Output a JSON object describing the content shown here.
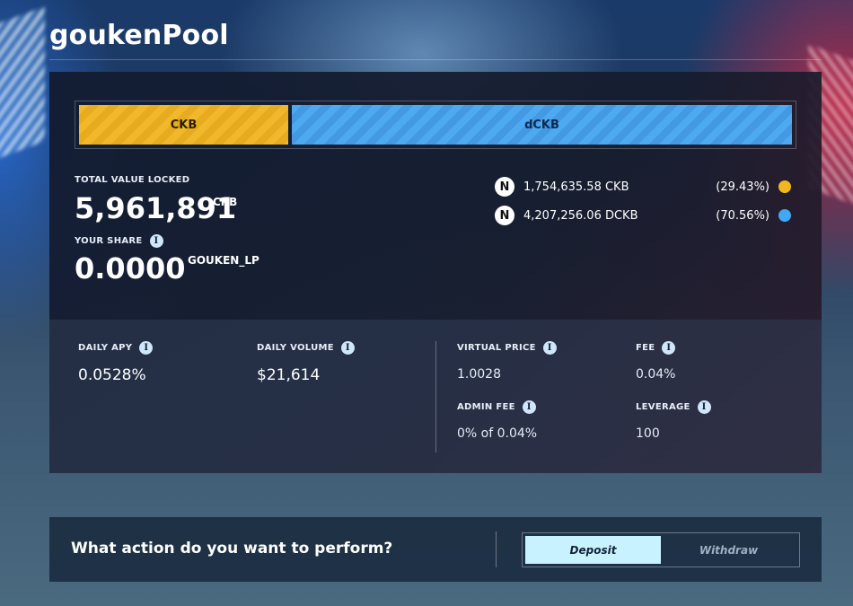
{
  "app": {
    "title": "goukenPool"
  },
  "pool": {
    "ratio_bar": {
      "ckb_label": "CKB",
      "dckb_label": "dCKB",
      "ckb_share": 0.2943,
      "dckb_share": 0.7056
    },
    "tvl": {
      "label": "TOTAL VALUE LOCKED",
      "value": "5,961,891",
      "unit": "CKB"
    },
    "share": {
      "label": "YOUR SHARE",
      "value": "0.0000",
      "unit": "GOUKEN_LP"
    },
    "assets": [
      {
        "icon": "token-icon",
        "amount": "1,754,635.58 CKB",
        "percent": "(29.43%)",
        "color": "#f2b61f"
      },
      {
        "icon": "token-icon",
        "amount": "4,207,256.06 DCKB",
        "percent": "(70.56%)",
        "color": "#3fa9f5"
      }
    ]
  },
  "metrics": {
    "daily_apy": {
      "label": "DAILY APY",
      "value": "0.0528%"
    },
    "daily_volume": {
      "label": "DAILY VOLUME",
      "value": "$21,614"
    },
    "virtual_price": {
      "label": "VIRTUAL PRICE",
      "value": "1.0028"
    },
    "fee": {
      "label": "FEE",
      "value": "0.04%"
    },
    "admin_fee": {
      "label": "ADMIN FEE",
      "value": "0% of 0.04%"
    },
    "leverage": {
      "label": "LEVERAGE",
      "value": "100"
    }
  },
  "info_icon_glyph": "i",
  "action": {
    "question": "What action do you want to perform?",
    "deposit_label": "Deposit",
    "withdraw_label": "Withdraw",
    "selected": "Deposit"
  }
}
